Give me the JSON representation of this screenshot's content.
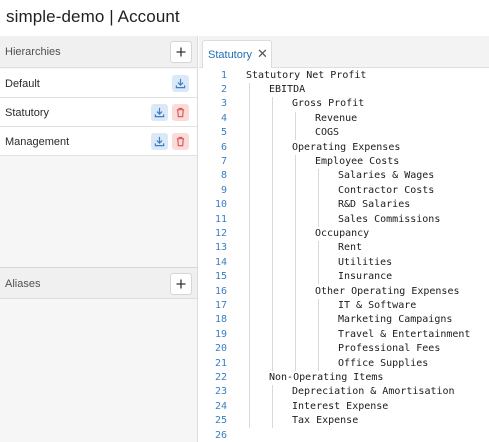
{
  "app": {
    "title": "simple-demo | Account"
  },
  "hierarchies": {
    "header_label": "Hierarchies",
    "items": [
      {
        "label": "Default",
        "has_download": true,
        "has_delete": false
      },
      {
        "label": "Statutory",
        "has_download": true,
        "has_delete": true
      },
      {
        "label": "Management",
        "has_download": true,
        "has_delete": true
      }
    ]
  },
  "aliases": {
    "header_label": "Aliases"
  },
  "editor": {
    "tab_label": "Statutory",
    "tab_close": "✕",
    "lines": [
      {
        "no": "1",
        "depth": 0,
        "text": "Statutory Net Profit"
      },
      {
        "no": "2",
        "depth": 1,
        "text": "EBITDA"
      },
      {
        "no": "3",
        "depth": 2,
        "text": "Gross Profit"
      },
      {
        "no": "4",
        "depth": 3,
        "text": "Revenue"
      },
      {
        "no": "5",
        "depth": 3,
        "text": "COGS"
      },
      {
        "no": "6",
        "depth": 2,
        "text": "Operating Expenses"
      },
      {
        "no": "7",
        "depth": 3,
        "text": "Employee Costs"
      },
      {
        "no": "8",
        "depth": 4,
        "text": "Salaries & Wages"
      },
      {
        "no": "9",
        "depth": 4,
        "text": "Contractor Costs"
      },
      {
        "no": "10",
        "depth": 4,
        "text": "R&D Salaries"
      },
      {
        "no": "11",
        "depth": 4,
        "text": "Sales Commissions"
      },
      {
        "no": "12",
        "depth": 3,
        "text": "Occupancy"
      },
      {
        "no": "13",
        "depth": 4,
        "text": "Rent"
      },
      {
        "no": "14",
        "depth": 4,
        "text": "Utilities"
      },
      {
        "no": "15",
        "depth": 4,
        "text": "Insurance"
      },
      {
        "no": "16",
        "depth": 3,
        "text": "Other Operating Expenses"
      },
      {
        "no": "17",
        "depth": 4,
        "text": "IT & Software"
      },
      {
        "no": "18",
        "depth": 4,
        "text": "Marketing Campaigns"
      },
      {
        "no": "19",
        "depth": 4,
        "text": "Travel & Entertainment"
      },
      {
        "no": "20",
        "depth": 4,
        "text": "Professional Fees"
      },
      {
        "no": "21",
        "depth": 4,
        "text": "Office Supplies"
      },
      {
        "no": "22",
        "depth": 1,
        "text": "Non-Operating Items"
      },
      {
        "no": "23",
        "depth": 2,
        "text": "Depreciation & Amortisation"
      },
      {
        "no": "24",
        "depth": 2,
        "text": "Interest Expense"
      },
      {
        "no": "25",
        "depth": 2,
        "text": "Tax Expense"
      },
      {
        "no": "26",
        "depth": 0,
        "text": ""
      }
    ]
  },
  "colors": {
    "line_number": "#3a7fc4",
    "tab_label": "#1f6fb5",
    "download_bg": "#dbe8f7",
    "download_icon": "#3a7fc4",
    "delete_bg": "#fbdada",
    "delete_icon": "#d9534f"
  },
  "icons": {
    "add": "plus-icon",
    "download": "download-icon",
    "delete": "trash-icon",
    "close": "close-icon"
  }
}
